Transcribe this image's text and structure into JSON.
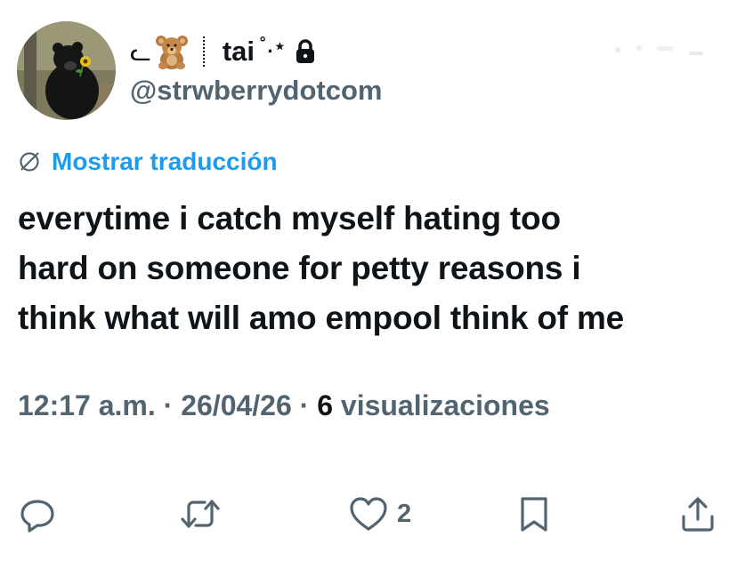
{
  "user": {
    "display_name_prefix": "ᓚ",
    "display_name": "tai",
    "display_name_suffix": "˚.⋆",
    "handle": "@strwberrydotcom",
    "avatar_icon": "black-bear-with-sunflower",
    "badge_icon": "teddy-bear-emoji",
    "protected_icon": "lock-icon"
  },
  "translate": {
    "label": "Mostrar traducción",
    "icon": "globe-slash-icon",
    "color": "#1d9bf0"
  },
  "tweet": {
    "lines": [
      "everytime i catch myself hating too",
      "hard on someone for petty reasons i",
      "think what will amo empool think of me"
    ]
  },
  "meta": {
    "time": "12:17 a.m.",
    "sep1": " · ",
    "date": "26/04/26",
    "sep2": " · ",
    "views_count": "6",
    "views_label": " visualizaciones"
  },
  "actions": {
    "reply_icon": "reply-icon",
    "retweet_icon": "retweet-icon",
    "like_icon": "heart-icon",
    "like_count": "2",
    "bookmark_icon": "bookmark-icon",
    "share_icon": "share-icon",
    "icon_color": "#536471"
  }
}
